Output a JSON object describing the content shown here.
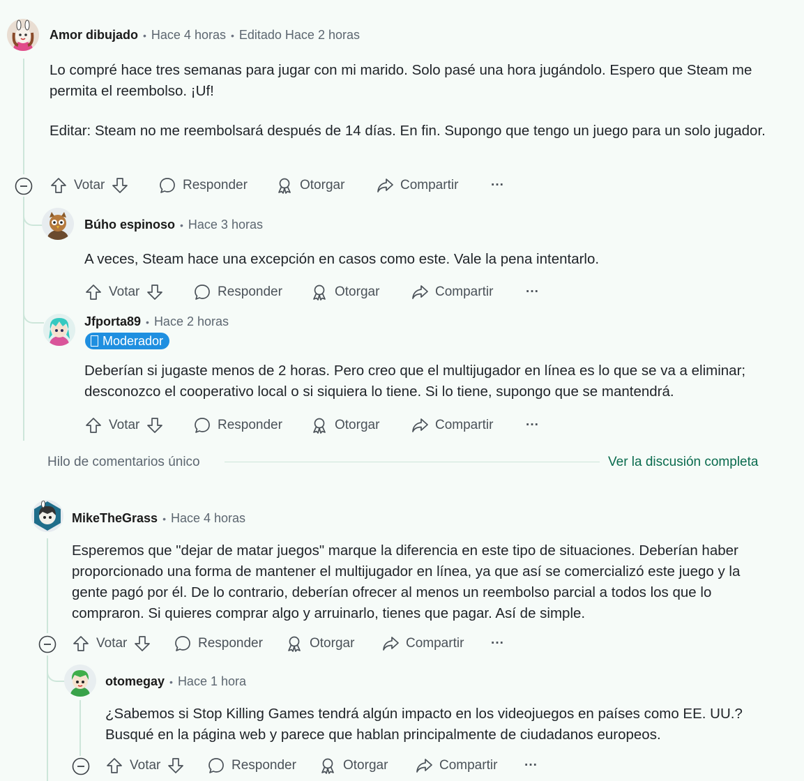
{
  "actions": {
    "vote": "Votar",
    "reply": "Responder",
    "award": "Otorgar",
    "share": "Compartir",
    "more": "···"
  },
  "comments": [
    {
      "author": "Amor dibujado",
      "time": "Hace 4 horas",
      "edited": "Editado Hace 2 horas",
      "paragraphs": [
        "Lo compré hace tres semanas para jugar con mi marido. Solo pasé una hora jugándolo. Espero que Steam me permita el reembolso. ¡Uf!",
        "Editar: Steam no me reembolsará después de 14 días. En fin. Supongo que tengo un juego para un solo jugador."
      ]
    },
    {
      "author": "Búho espinoso",
      "time": "Hace 3 horas",
      "paragraphs": [
        "A veces, Steam hace una excepción en casos como este. Vale la pena intentarlo."
      ]
    },
    {
      "author": "Jfporta89",
      "time": "Hace 2 horas",
      "badge": "Moderador",
      "paragraphs": [
        "Deberían si jugaste menos de 2 horas. Pero creo que el multijugador en línea es lo que se va a eliminar; desconozco el cooperativo local o si siquiera lo tiene. Si lo tiene, supongo que se mantendrá."
      ]
    },
    {
      "author": "MikeTheGrass",
      "time": "Hace 4 horas",
      "paragraphs": [
        "Esperemos que \"dejar de matar juegos\" marque la diferencia en este tipo de situaciones. Deberían haber proporcionado una forma de mantener el multijugador en línea, ya que así se comercializó este juego y la gente pagó por él. De lo contrario, deberían ofrecer al menos un reembolso parcial a todos los que lo compraron. Si quieres comprar algo y arruinarlo, tienes que pagar. Así de simple."
      ]
    },
    {
      "author": "otomegay",
      "time": "Hace 1 hora",
      "paragraphs": [
        "¿Sabemos si Stop Killing Games tendrá algún impacto en los videojuegos en países como EE. UU.? Busqué en la página web y parece que hablan principalmente de ciudadanos europeos."
      ]
    }
  ],
  "thread_footer": {
    "label": "Hilo de comentarios único",
    "link": "Ver la discusión completa"
  }
}
